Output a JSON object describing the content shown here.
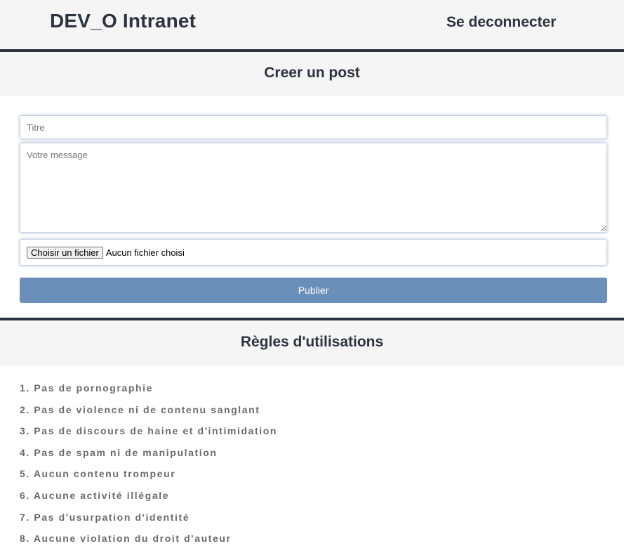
{
  "header": {
    "brand": "DEV_O Intranet",
    "logout_label": "Se deconnecter"
  },
  "create_post": {
    "heading": "Creer un post",
    "title_placeholder": "Titre",
    "message_placeholder": "Votre message",
    "file_button_label": "Choisir un fichier",
    "file_status": "Aucun fichier choisi",
    "publish_label": "Publier"
  },
  "rules": {
    "heading": "Règles d'utilisations",
    "items": [
      "1. Pas de pornographie",
      "2. Pas de violence ni de contenu sanglant",
      "3. Pas de discours de haine et d'intimidation",
      "4. Pas de spam ni de manipulation",
      "5. Aucun contenu trompeur",
      "6. Aucune activité illégale",
      "7. Pas d'usurpation d'identité",
      "8. Aucune violation du droit d'auteur"
    ]
  },
  "colors": {
    "primary_dark": "#2c3440",
    "header_bg": "#f5f5f5",
    "publish_button": "#6a8fb8",
    "rule_text": "#6b6b6b"
  }
}
